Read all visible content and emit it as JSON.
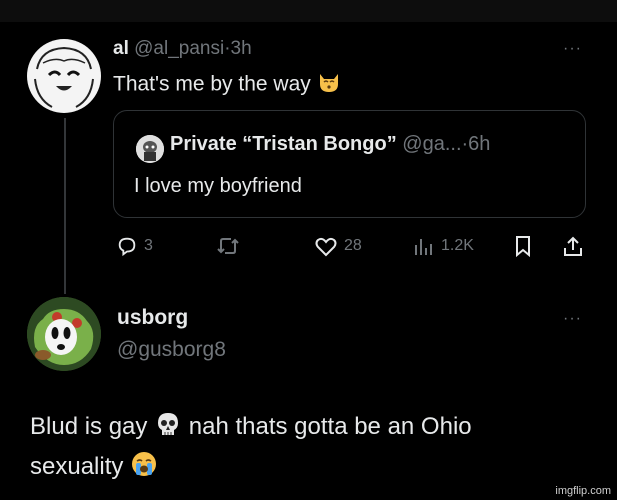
{
  "tweet1": {
    "display_name": "al",
    "handle": "@al_pansi",
    "separator": "·",
    "time": "3h",
    "text": "That's me by the way",
    "emoji_icon": "kissing-cat-emoji",
    "more": "···"
  },
  "quote": {
    "display_name": "Private “Tristan Bongo”",
    "handle": "@ga...",
    "separator": "·",
    "time": "6h",
    "text": "I love my boyfriend"
  },
  "actions": {
    "replies": "3",
    "retweets": "",
    "likes": "28",
    "views": "1.2K"
  },
  "tweet2": {
    "display_name": "usborg",
    "handle": "@gusborg8",
    "more": "···",
    "line1": "Blud is gay",
    "line1_emoji": "skull-emoji",
    "line1_rest": "nah thats gotta be an Ohio",
    "line2": "sexuality",
    "line2_emoji": "crying-face-emoji"
  },
  "watermark": "imgflip.com",
  "colors": {
    "background": "#000000",
    "text": "#e7e9ea",
    "muted": "#71767b",
    "border": "#2f3336"
  }
}
